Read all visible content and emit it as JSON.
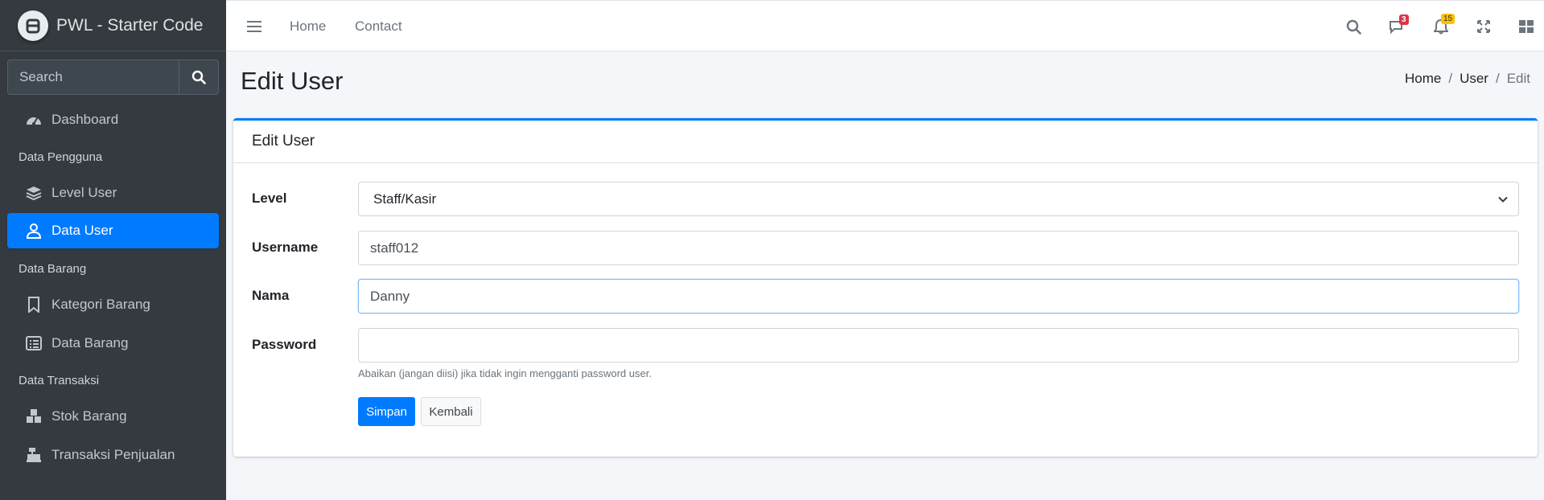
{
  "brand": {
    "title": "PWL - Starter Code"
  },
  "sidebar": {
    "search_placeholder": "Search",
    "items": [
      {
        "label": "Dashboard",
        "icon": "dashboard-icon"
      },
      {
        "header": "Data Pengguna"
      },
      {
        "label": "Level User",
        "icon": "layers-icon"
      },
      {
        "label": "Data User",
        "icon": "user-icon",
        "active": true
      },
      {
        "header": "Data Barang"
      },
      {
        "label": "Kategori Barang",
        "icon": "bookmark-icon"
      },
      {
        "label": "Data Barang",
        "icon": "list-icon"
      },
      {
        "header": "Data Transaksi"
      },
      {
        "label": "Stok Barang",
        "icon": "cubes-icon"
      },
      {
        "label": "Transaksi Penjualan",
        "icon": "cash-register-icon"
      }
    ]
  },
  "topbar": {
    "links": [
      "Home",
      "Contact"
    ],
    "messages_badge": "3",
    "notifications_badge": "15",
    "colors": {
      "danger": "#dc3545",
      "warning": "#ffc107"
    }
  },
  "page": {
    "title": "Edit User",
    "breadcrumb": [
      "Home",
      "User",
      "Edit"
    ]
  },
  "form": {
    "card_title": "Edit User",
    "level_label": "Level",
    "level_value": "Staff/Kasir",
    "username_label": "Username",
    "username_value": "staff012",
    "nama_label": "Nama",
    "nama_value": "Danny",
    "password_label": "Password",
    "password_value": "",
    "password_help": "Abaikan (jangan diisi) jika tidak ingin mengganti password user.",
    "submit_label": "Simpan",
    "back_label": "Kembali"
  },
  "theme": {
    "accent": "#007bff",
    "sidebar_bg": "#343a40"
  }
}
